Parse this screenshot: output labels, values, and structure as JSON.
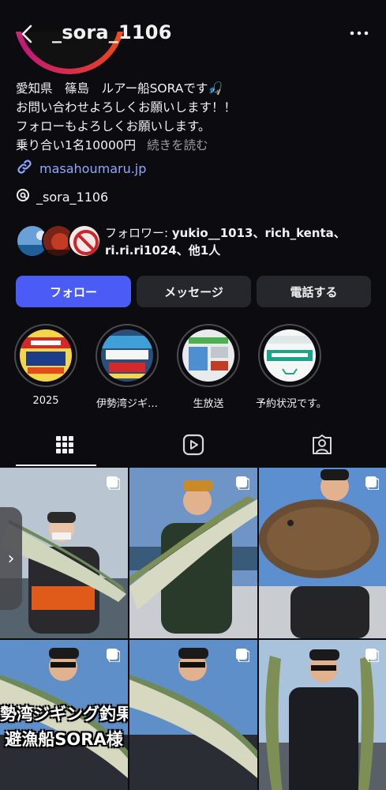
{
  "header": {
    "username": "_sora_1106",
    "back_icon": "chevron-left-icon",
    "more_icon": "more-horizontal-icon"
  },
  "bio": {
    "line1": "愛知県　篠島　ルアー船SORAです🎣",
    "line2": "お問い合わせよろしくお願いします！！",
    "line3": "フォローもよろしくお願いします。",
    "line4": "乗り合い1名10000円",
    "more_label": "続きを読む"
  },
  "link": {
    "icon": "link-icon",
    "text": "masahoumaru.jp"
  },
  "threads": {
    "icon": "threads-icon",
    "text": "_sora_1106"
  },
  "followers": {
    "prefix": "フォロワー: ",
    "names_line1": "yukio__1013、rich_kenta、",
    "names_line2": "ri.ri.ri1024、他1人"
  },
  "actions": {
    "follow": "フォロー",
    "message": "メッセージ",
    "call": "電話する"
  },
  "highlights": [
    {
      "label": "2025"
    },
    {
      "label": "伊勢湾ジギ…"
    },
    {
      "label": "生放送"
    },
    {
      "label": "予約状況です。"
    }
  ],
  "tabs": [
    {
      "name": "grid",
      "icon": "grid-icon",
      "selected": true
    },
    {
      "name": "reels",
      "icon": "reels-play-icon",
      "selected": false
    },
    {
      "name": "tagged",
      "icon": "tagged-person-icon",
      "selected": false
    }
  ],
  "posts": {
    "overlay_line1": "勢湾ジギング釣果情",
    "overlay_line2": "避漁船SORA様"
  },
  "colors": {
    "background": "#0c0c10",
    "follow_button": "#4a5cf5",
    "secondary_button": "#26272d",
    "link": "#8fa8ff"
  }
}
